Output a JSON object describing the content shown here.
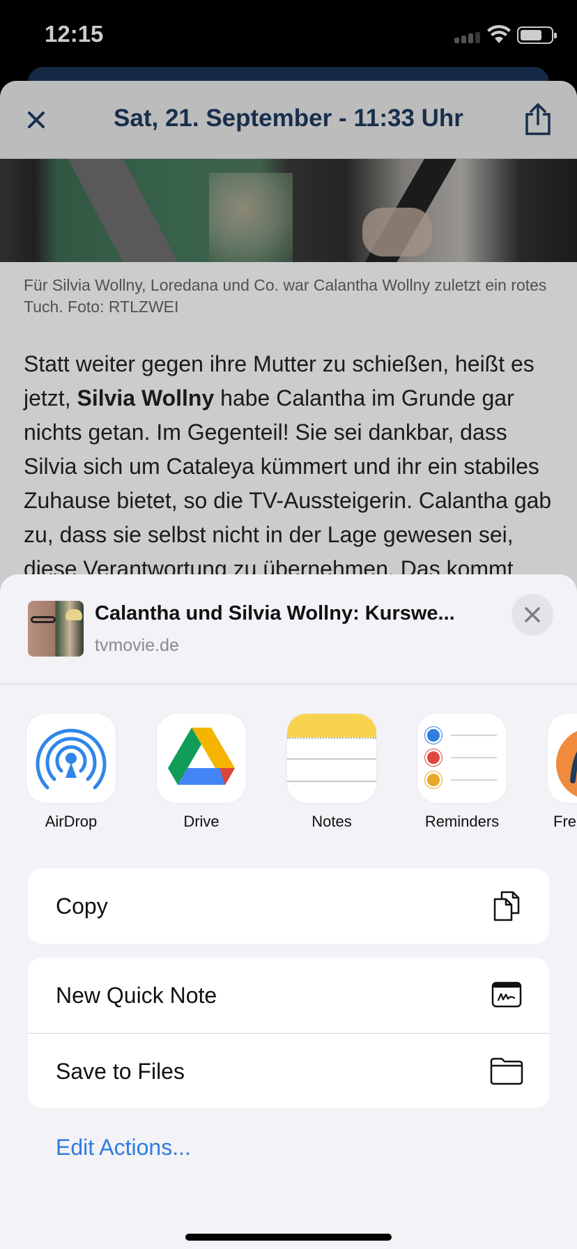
{
  "status_bar": {
    "time": "12:15"
  },
  "article": {
    "date_title": "Sat, 21. September - 11:33 Uhr",
    "caption": "Für Silvia Wollny, Loredana und Co. war Calantha Wollny zuletzt ein rotes Tuch. Foto: RTLZWEI",
    "body_part1": "Statt weiter gegen ihre Mutter zu schießen, heißt es jetzt, ",
    "body_bold": "Silvia Wollny",
    "body_part2": " habe Calantha im Grunde gar nichts getan. Im Gegenteil! Sie sei dankbar, dass Silvia sich um Cataleya kümmert und ihr ein stabiles Zuhause bietet, so die TV-Aussteigerin. Calantha gab zu, dass sie selbst nicht in der Lage gewesen sei, diese Verantwortung zu übernehmen. Das kommt"
  },
  "share_sheet": {
    "title": "Calantha und Silvia Wollny: Kurswe...",
    "domain": "tvmovie.de",
    "apps": [
      {
        "label": "AirDrop",
        "icon": "airdrop-icon"
      },
      {
        "label": "Drive",
        "icon": "google-drive-icon"
      },
      {
        "label": "Notes",
        "icon": "notes-icon"
      },
      {
        "label": "Reminders",
        "icon": "reminders-icon"
      },
      {
        "label": "Fre",
        "icon": "freeform-icon"
      }
    ],
    "actions_group1": [
      {
        "label": "Copy",
        "icon": "copy-icon"
      }
    ],
    "actions_group2": [
      {
        "label": "New Quick Note",
        "icon": "quick-note-icon"
      },
      {
        "label": "Save to Files",
        "icon": "folder-icon"
      }
    ],
    "edit_actions": "Edit Actions..."
  },
  "colors": {
    "header_title": "#1e3a5f",
    "link_blue": "#2f7de0",
    "sheet_background": "#f2f2f7"
  }
}
